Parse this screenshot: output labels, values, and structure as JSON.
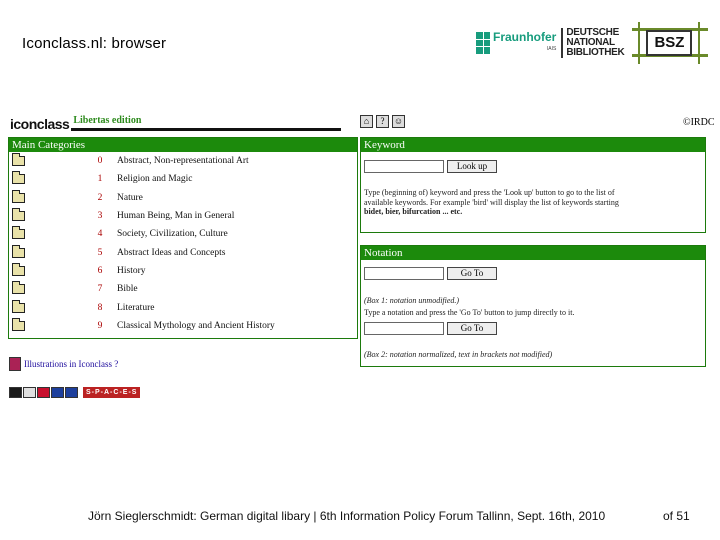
{
  "slide_title": "Iconclass.nl: browser",
  "logos": {
    "fraunhofer": "Fraunhofer",
    "fraunhofer_sub": "IAIS",
    "dnb_line1": "DEUTSCHE",
    "dnb_line2": "NATIONAL",
    "dnb_line3": "BIBLIOTHEK",
    "bsz": "BSZ"
  },
  "app": {
    "logo": "iconclass",
    "edition": "Libertas edition",
    "icons": [
      "home-icon",
      "help-icon",
      "portrait-icon"
    ],
    "copyright": "©IRDC",
    "main_categories": {
      "title": "Main Categories",
      "rows": [
        {
          "num": "0",
          "label": "Abstract, Non-representational Art"
        },
        {
          "num": "1",
          "label": "Religion and Magic"
        },
        {
          "num": "2",
          "label": "Nature"
        },
        {
          "num": "3",
          "label": "Human Being, Man in General"
        },
        {
          "num": "4",
          "label": "Society, Civilization, Culture"
        },
        {
          "num": "5",
          "label": "Abstract Ideas and Concepts"
        },
        {
          "num": "6",
          "label": "History"
        },
        {
          "num": "7",
          "label": "Bible"
        },
        {
          "num": "8",
          "label": "Literature"
        },
        {
          "num": "9",
          "label": "Classical Mythology and Ancient History"
        }
      ]
    },
    "keyword": {
      "title": "Keyword",
      "input_value": "",
      "button": "Look up",
      "help_line1": "Type (beginning of) keyword and press the 'Look up' button to go to the list of",
      "help_line2": "available keywords. For example 'bird' will display the list of keywords starting",
      "help_line3": "bidet, bier, bifurcation ... etc."
    },
    "notation": {
      "title": "Notation",
      "input1_value": "",
      "button1": "Go To",
      "box1_note": "(Box 1: notation unmodified.)",
      "help_line": "Type a notation and press the 'Go To' button to jump directly to it.",
      "input2_value": "",
      "button2": "Go To",
      "box2_note": "(Box 2: notation normalized, text in brackets not modified)"
    },
    "illustrations_link": "Illustrations in Iconclass ?",
    "flags": [
      "#1a1a1a",
      "#e0e0e0",
      "#c8102e",
      "#1d3f9c",
      "#1d3f9c"
    ],
    "spaces_badge": "S-P-A-C-E-S"
  },
  "footer": {
    "main": "Jörn Sieglerschmidt: German digital libary | 6th Information Policy Forum Tallinn, Sept. 16th, 2010",
    "page": "of 51"
  }
}
